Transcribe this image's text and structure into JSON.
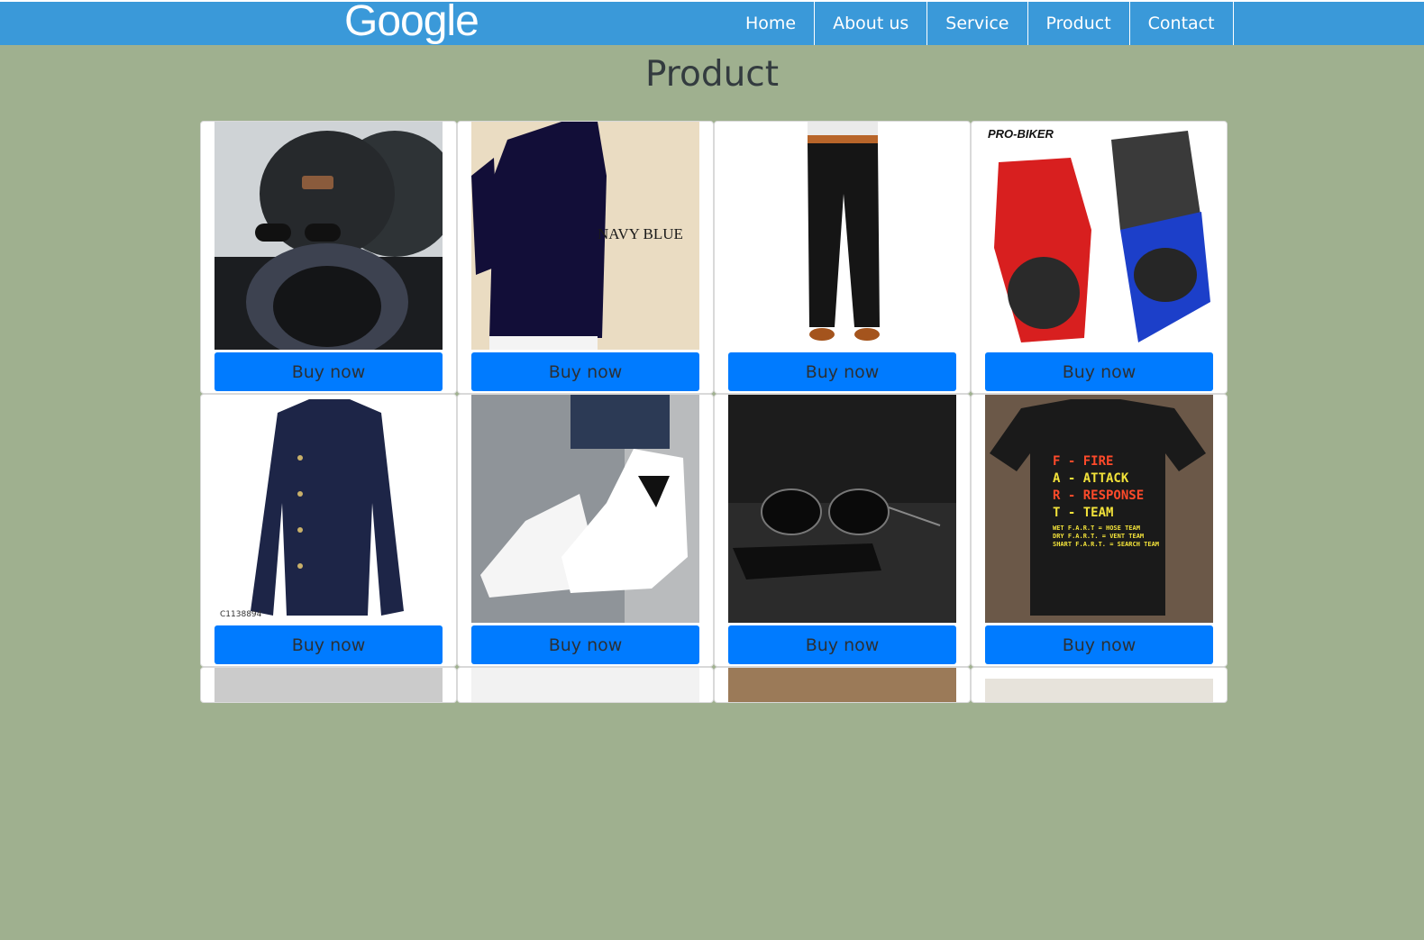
{
  "navbar": {
    "brand": "Google",
    "links": [
      "Home",
      "About us",
      "Service",
      "Product",
      "Contact"
    ]
  },
  "page": {
    "title": "Product"
  },
  "products": {
    "buy_label": "Buy now",
    "items": [
      {
        "name": "beanie-scarf",
        "image_text": ""
      },
      {
        "name": "navy-kurta",
        "image_text": "NAVY BLUE"
      },
      {
        "name": "black-trousers",
        "image_text": ""
      },
      {
        "name": "probiker-gloves",
        "image_text": "PRO-BIKER"
      },
      {
        "name": "navy-shirt",
        "image_text": "C1138894"
      },
      {
        "name": "white-sneakers",
        "image_text": ""
      },
      {
        "name": "sunglasses",
        "image_text": ""
      },
      {
        "name": "fart-tshirt",
        "image_text": "F - FIRE\nA - ATTACK\nR - RESPONSE\nT - TEAM\nWET F.A.R.T = HOSE TEAM\nDRY F.A.R.T. = VENT TEAM\nSHART F.A.R.T. = SEARCH TEAM"
      }
    ]
  },
  "colors": {
    "background": "#9fb08f",
    "navbar": "#3a99d9",
    "button": "#007bff"
  }
}
